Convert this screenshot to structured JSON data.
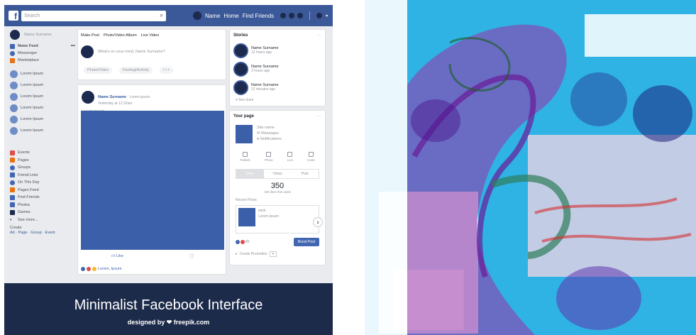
{
  "topbar": {
    "logo": "f",
    "search_placeholder": "Search",
    "profile_name": "Name",
    "home": "Home",
    "find_friends": "Find Friends"
  },
  "sidebar": {
    "profile_name": "Name Surname",
    "items": [
      {
        "label": "News Feed"
      },
      {
        "label": "Messenger"
      },
      {
        "label": "Marketplace"
      }
    ],
    "groups": [
      {
        "label": "Lorem Ipsum"
      },
      {
        "label": "Lorem Ipsum"
      },
      {
        "label": "Lorem Ipsum"
      },
      {
        "label": "Lorem Ipsum"
      },
      {
        "label": "Lorem Ipsum"
      },
      {
        "label": "Lorem Ipsum"
      }
    ],
    "explore": [
      {
        "label": "Events"
      },
      {
        "label": "Pages"
      },
      {
        "label": "Groups"
      },
      {
        "label": "Friend Lists"
      },
      {
        "label": "On This Day"
      },
      {
        "label": "Pages Feed"
      },
      {
        "label": "Find Friends"
      },
      {
        "label": "Photos"
      },
      {
        "label": "Games"
      },
      {
        "label": "See more..."
      }
    ],
    "create_label": "Create",
    "create_links": "Ad · Page · Group · Event"
  },
  "composer": {
    "tabs": [
      "Make Post",
      "Photo/Video Album",
      "Live Video"
    ],
    "placeholder": "What's on your mind, Name Surname?",
    "photo_video": "Photo/Video",
    "feeling": "Feeling/Activity",
    "more": "• • •"
  },
  "post": {
    "author": "Name Surname",
    "author_sub": "Lorem ipsum",
    "time": "Yesterday at 12:32am",
    "text": "Lorem ipsum.",
    "like": "Like",
    "reactions": "Lorem, Ipsum"
  },
  "stories": {
    "title": "Stories",
    "items": [
      {
        "name": "Name Surname",
        "time": "12 hours ago"
      },
      {
        "name": "Name Surname",
        "time": "2 hours ago"
      },
      {
        "name": "Name Surname",
        "time": "12 minutes ago"
      }
    ],
    "see_more": "See more"
  },
  "your_page": {
    "title": "Your page",
    "site_name": "Site name",
    "messages": "Messages",
    "notifications": "Notifications",
    "tools": [
      "Publish",
      "Photo",
      "Live",
      "Invite"
    ],
    "tabs": [
      "Likes",
      "Views",
      "Post"
    ],
    "count": "350",
    "count_sub": "150 likes this week",
    "recent": "Recent Posts",
    "recent_title": "work",
    "recent_text": "Lorem ipsum",
    "boost": "Boost Post",
    "reacts": "85",
    "promotion": "Create Promotion"
  },
  "footer": {
    "title": "Minimalist Facebook Interface",
    "designed_by": "designed by ❤ freepik.com"
  }
}
